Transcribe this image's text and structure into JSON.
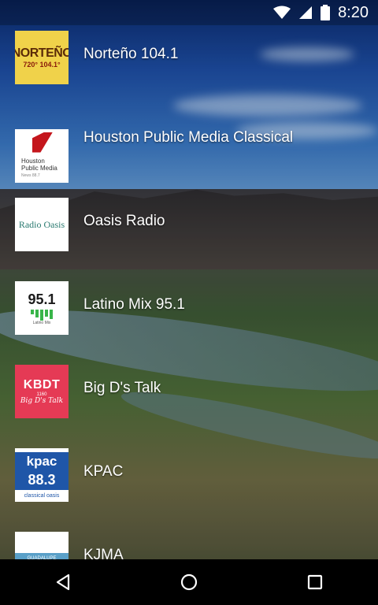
{
  "status_bar": {
    "time": "8:20",
    "icons": [
      "wifi-icon",
      "signal-icon",
      "battery-icon"
    ]
  },
  "stations": [
    {
      "name": "Norteño 104.1",
      "logo": {
        "brand": "NORTEÑO",
        "freq": "720° 104.1°"
      }
    },
    {
      "name": "Houston Public Media Classical",
      "logo": {
        "line1": "Houston",
        "line2": "Public Media",
        "sub": "News 88.7"
      }
    },
    {
      "name": "Oasis Radio",
      "logo": {
        "text": "Radio Oasis"
      }
    },
    {
      "name": "Latino Mix 95.1",
      "logo": {
        "num": "95.1",
        "sub": "Latino Mix"
      }
    },
    {
      "name": "Big D's Talk",
      "logo": {
        "call": "KBDT",
        "freq": "1160",
        "sub": "Big D's Talk"
      }
    },
    {
      "name": "KPAC",
      "logo": {
        "call": "kpac",
        "freq": "88.3",
        "sub": "classical oasis"
      }
    },
    {
      "name": "KJMA",
      "logo": {
        "band": "GUADALUPE"
      }
    }
  ],
  "nav_bar": {
    "buttons": [
      "back-icon",
      "home-icon",
      "recents-icon"
    ]
  },
  "colors": {
    "status_bar_bg": "#00000040",
    "nav_bar_bg": "#000000",
    "text": "#ffffff"
  }
}
